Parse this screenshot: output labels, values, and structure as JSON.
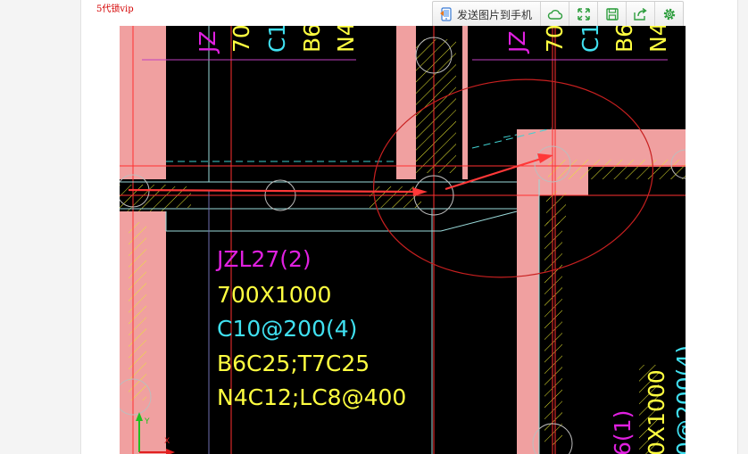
{
  "user_tag": "5代锁vip",
  "toolbar": {
    "send_label": "发送图片到手机",
    "buttons": [
      {
        "name": "cloud-icon"
      },
      {
        "name": "fullscreen-icon"
      },
      {
        "name": "save-icon"
      },
      {
        "name": "share-icon"
      },
      {
        "name": "settings-icon"
      }
    ]
  },
  "colors": {
    "wall": "#f0a0a0",
    "hatch": "#ffff40",
    "beam_label": "#e020e0",
    "rebar_label": "#40e0f0",
    "text": "#ffff40",
    "axis": "#ff3030",
    "annotation_ellipse": "#c02020",
    "arrow": "#ff3333"
  },
  "cad": {
    "beam_label": {
      "name": "JZL27(2)",
      "size": "700X1000",
      "stirrup": "C10@200(4)",
      "main_bars": "B6C25;T7C25",
      "side_bars": "N4C12;LC8@400"
    },
    "top_left_label": [
      "JZ",
      "70",
      "C1",
      "B6",
      "N4"
    ],
    "top_right_label": [
      "JZ",
      "70",
      "C1",
      "B6",
      "N4"
    ],
    "bottom_right_label": {
      "size": "0X1000",
      "name": "6(1)",
      "stirrup": "0@200(4)"
    },
    "ucs": {
      "x": "X",
      "y": "Y"
    }
  }
}
